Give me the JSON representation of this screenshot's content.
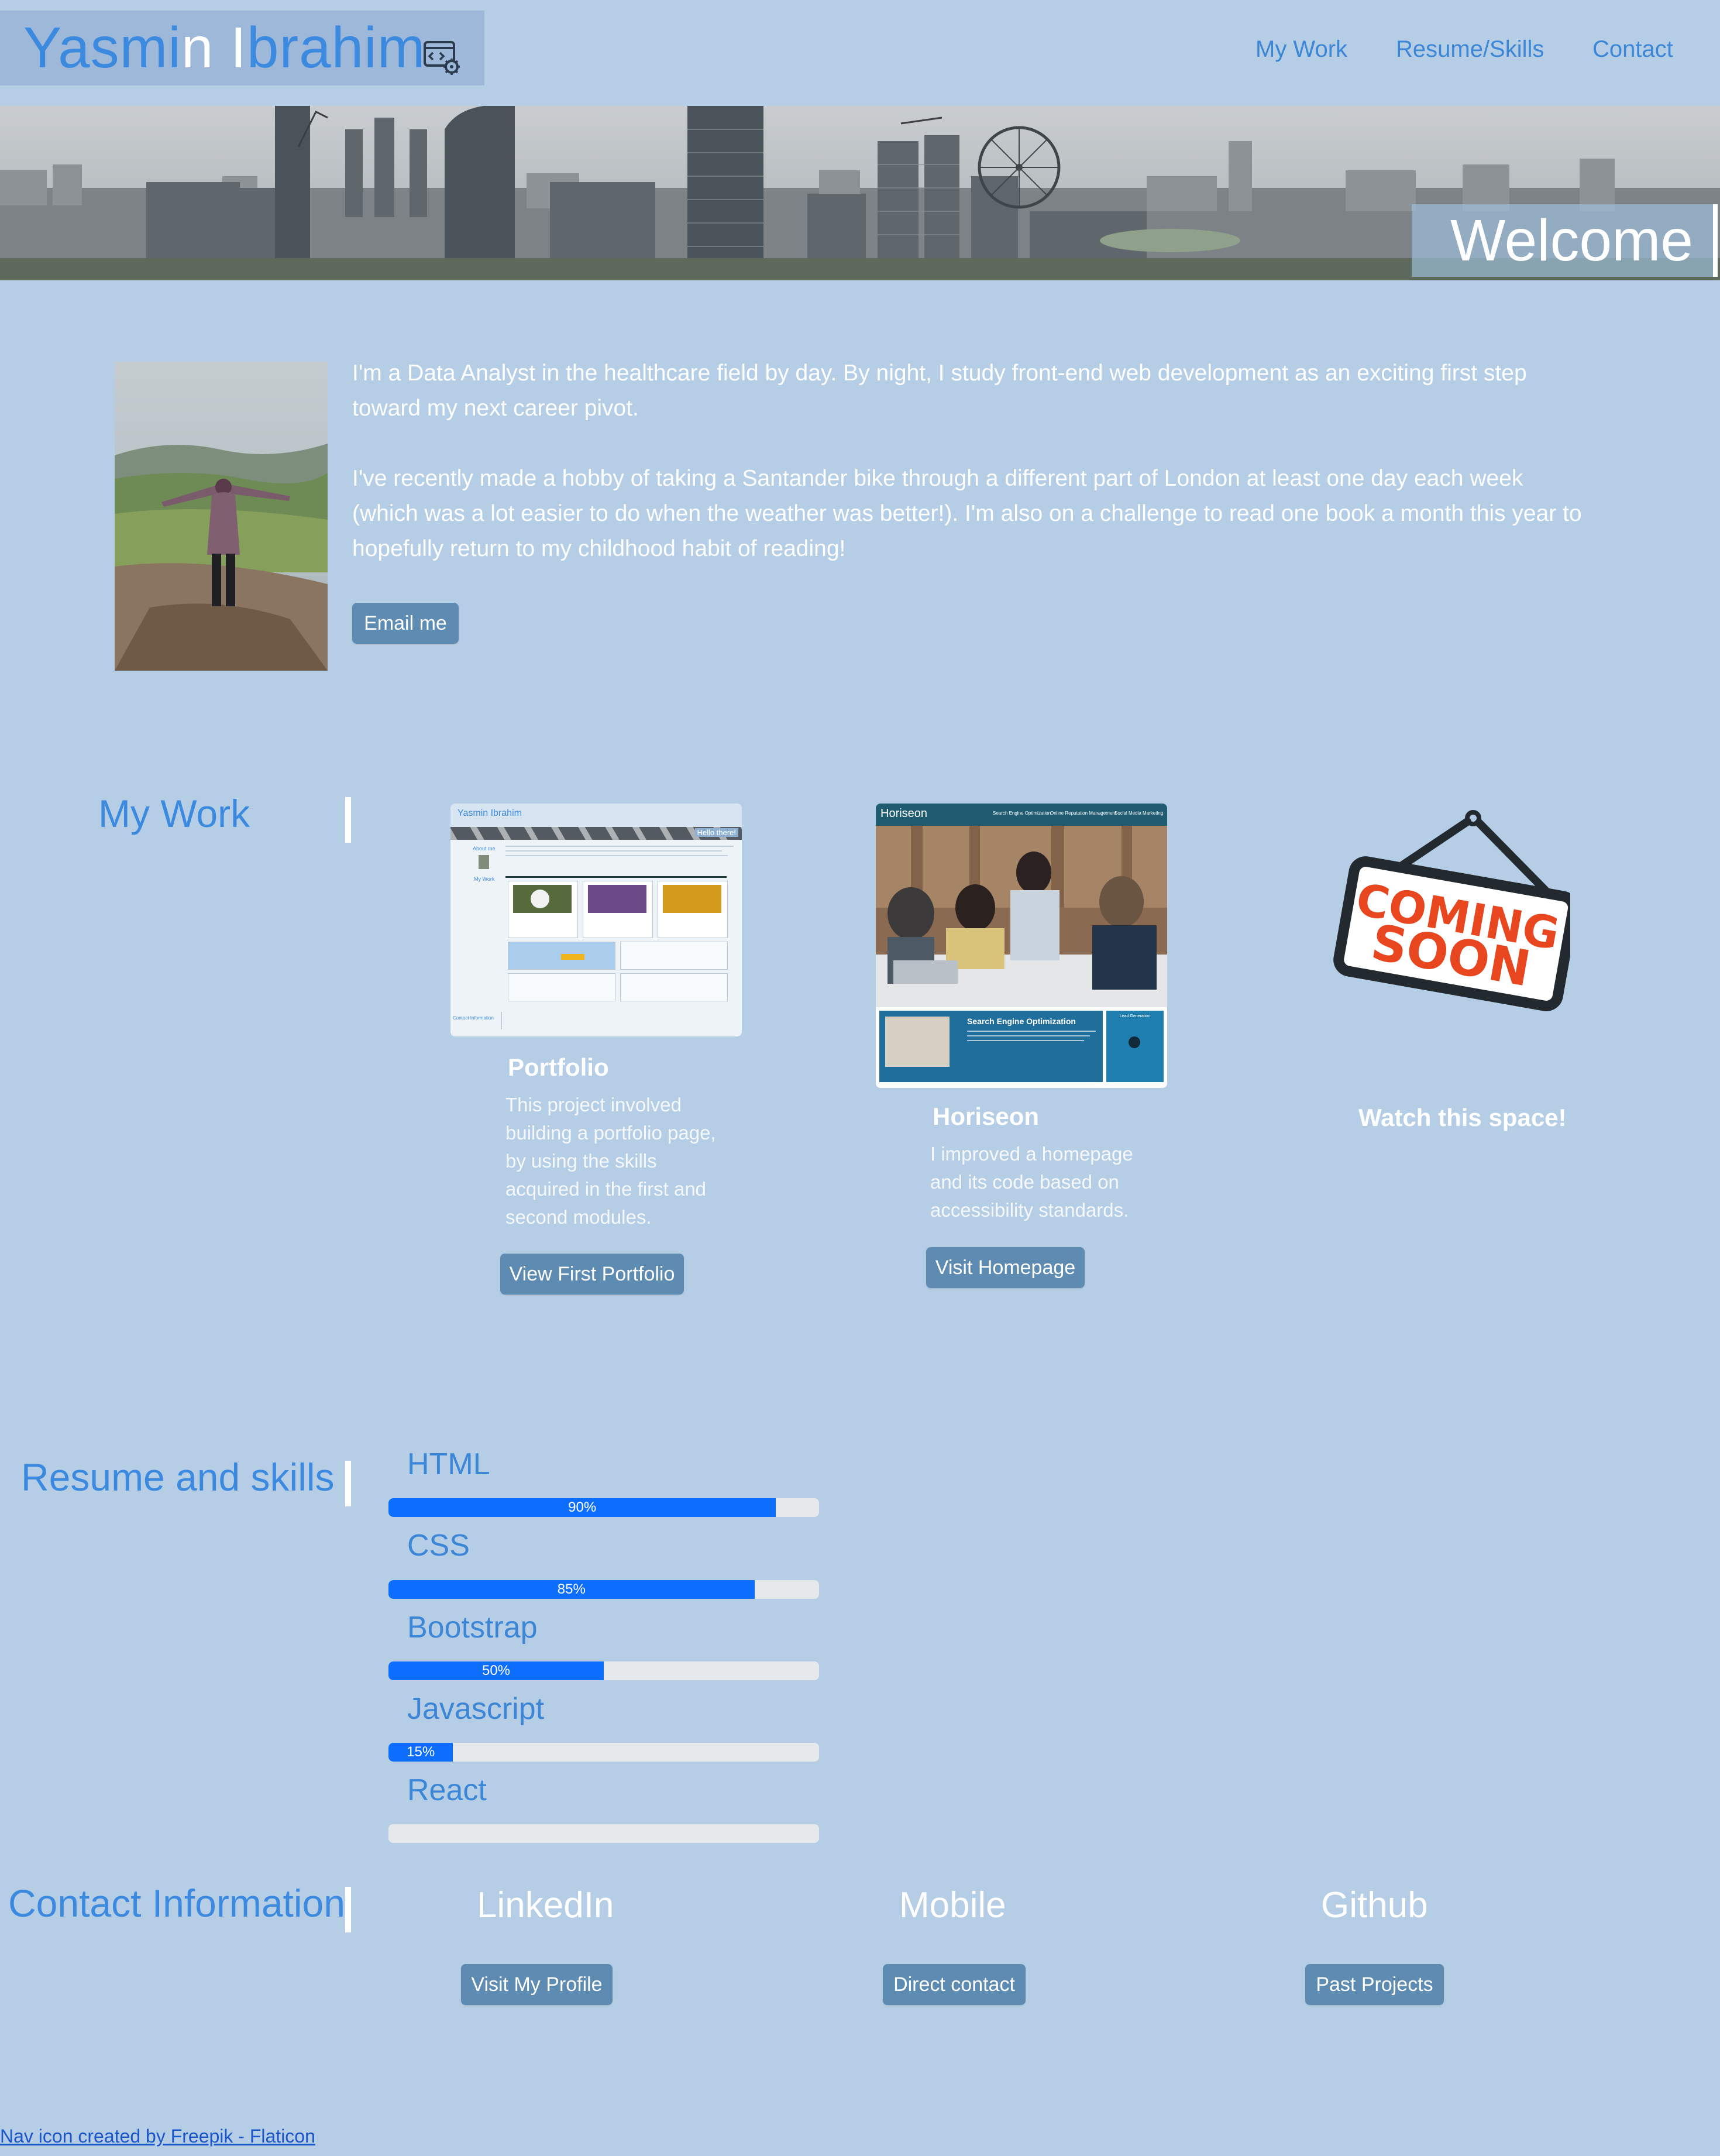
{
  "header": {
    "brand_part1": "Yasmi",
    "brand_part2": "n",
    "brand_part3": " I",
    "brand_part4": "brahim",
    "brand_icon": "code-settings-icon",
    "nav": [
      "My Work",
      "Resume/Skills",
      "Contact"
    ]
  },
  "hero": {
    "welcome": "Welcome",
    "image": "london-skyline-photo"
  },
  "about": {
    "paragraph1": "I'm a Data Analyst in the healthcare field by day. By night, I study front-end web development as an exciting first step toward my next career pivot.",
    "paragraph2": "I've recently made a hobby of taking a Santander bike through a different part of London at least one day each week (which was a lot easier to do when the weather was better!). I'm also on a challenge to read one book a month this year to hopefully return to my childhood habit of reading!",
    "email_button": "Email me"
  },
  "work": {
    "heading": "My Work",
    "projects": [
      {
        "title": "Portfolio",
        "description": "This project involved building a portfolio page, by using the skills acquired in the first and second modules.",
        "button": "View First Portfolio",
        "thumb": {
          "brand": "Yasmin Ibrahim",
          "banner": "Hello there!",
          "sidebar_about": "About me",
          "sidebar_work": "My Work",
          "footer_label": "Contact Information"
        }
      },
      {
        "title": "Horiseon",
        "description": "I improved a homepage and its code based on accessibility standards.",
        "button": "Visit Homepage",
        "thumb": {
          "brand": "Horiseon",
          "nav": [
            "Search Engine Optimization",
            "Online Reputation Management",
            "Social Media Marketing"
          ],
          "panel_title": "Search Engine Optimization",
          "side_title": "Lead Generation"
        }
      },
      {
        "title": "Watch this space!",
        "sign_line1": "COMING",
        "sign_line2": "SOON"
      }
    ]
  },
  "skills": {
    "heading": "Resume and skills",
    "items": [
      {
        "name": "HTML",
        "percent": 90,
        "label": "90%"
      },
      {
        "name": "CSS",
        "percent": 85,
        "label": "85%"
      },
      {
        "name": "Bootstrap",
        "percent": 50,
        "label": "50%"
      },
      {
        "name": "Javascript",
        "percent": 15,
        "label": "15%"
      },
      {
        "name": "React",
        "percent": 0,
        "label": ""
      }
    ]
  },
  "contact": {
    "heading": "Contact Information",
    "items": [
      {
        "title": "LinkedIn",
        "button": "Visit My Profile"
      },
      {
        "title": "Mobile",
        "button": "Direct contact"
      },
      {
        "title": "Github",
        "button": "Past Projects"
      }
    ]
  },
  "footer": {
    "credit": "Nav icon created by Freepik - Flaticon"
  },
  "colors": {
    "background": "#b6cee5",
    "accent": "#3b8ae0",
    "button": "#5d8bb2",
    "progress": "#0d6efd"
  }
}
